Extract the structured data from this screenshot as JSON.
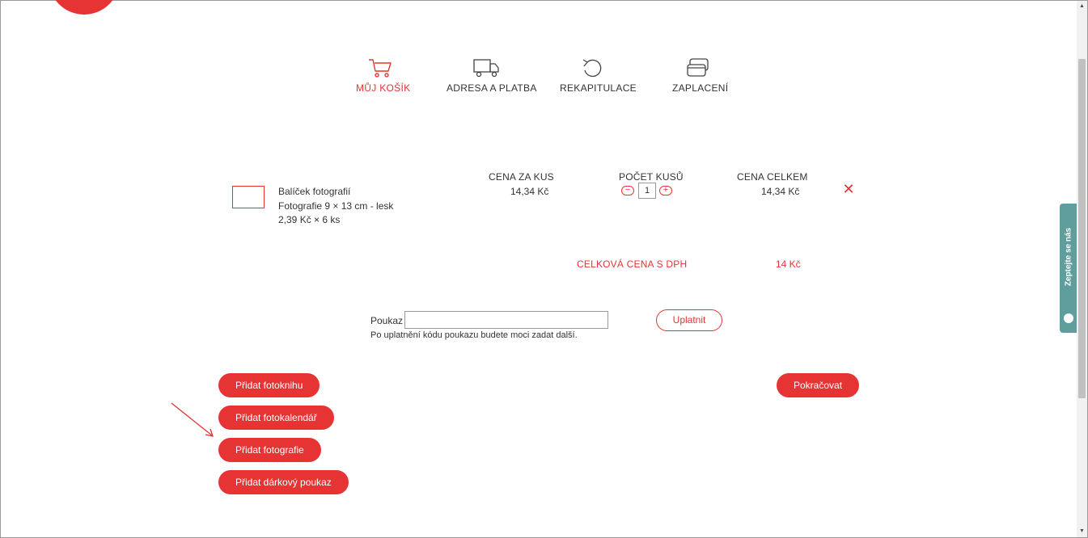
{
  "steps": [
    {
      "label": "MŮJ KOŠÍK",
      "icon": "cart-icon",
      "active": true
    },
    {
      "label": "ADRESA A PLATBA",
      "icon": "truck-icon",
      "active": false
    },
    {
      "label": "REKAPITULACE",
      "icon": "undo-icon",
      "active": false
    },
    {
      "label": "ZAPLACENÍ",
      "icon": "credit-card-icon",
      "active": false
    }
  ],
  "cart": {
    "headers": {
      "unit_price": "CENA ZA KUS",
      "quantity": "POČET KUSŮ",
      "total": "CENA CELKEM"
    },
    "items": [
      {
        "name": "Balíček fotografií",
        "description": "Fotografie 9 × 13 cm - lesk",
        "quantity_detail": "2,39 Kč × 6 ks",
        "unit_price": "14,34 Kč",
        "quantity": "1",
        "total": "14,34 Kč"
      }
    ],
    "grand_total_label": "CELKOVÁ CENA S DPH",
    "grand_total_value": "14 Kč"
  },
  "voucher": {
    "label": "Poukaz",
    "value": "",
    "note": "Po uplatnění kódu poukazu budete moci zadat další.",
    "apply_label": "Uplatnit"
  },
  "actions": {
    "add_photobook": "Přidat fotoknihu",
    "add_calendar": "Přidat fotokalendář",
    "add_photos": "Přidat fotografie",
    "add_gift_voucher": "Přidat dárkový poukaz",
    "continue": "Pokračovat"
  },
  "contact_tab": {
    "label": "Zeptejte se nás"
  },
  "colors": {
    "accent": "#e63434",
    "contact_tab": "#5f9e9c"
  }
}
